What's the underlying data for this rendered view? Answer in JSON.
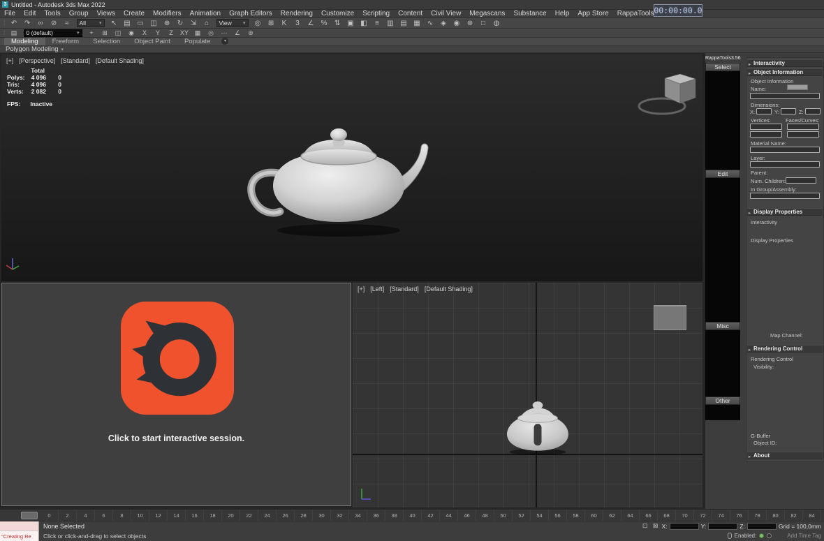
{
  "titlebar": {
    "app_icon": "3",
    "title": "Untitled - Autodesk 3ds Max 2022"
  },
  "menubar": {
    "items": [
      "File",
      "Edit",
      "Tools",
      "Group",
      "Views",
      "Create",
      "Modifiers",
      "Animation",
      "Graph Editors",
      "Rendering",
      "Customize",
      "Scripting",
      "Content",
      "Civil View",
      "Megascans",
      "Substance",
      "Help",
      "App Store",
      "RappaTools3"
    ]
  },
  "overlay": {
    "timecode": "00:00:00.0"
  },
  "toolbar1": {
    "filter_value": "All",
    "coord_value": "View",
    "icons_a": [
      {
        "name": "undo-icon",
        "glyph": "↶"
      },
      {
        "name": "redo-icon",
        "glyph": "↷"
      },
      {
        "name": "select-and-link-icon",
        "glyph": "∞"
      },
      {
        "name": "unlink-selection-icon",
        "glyph": "⊘"
      },
      {
        "name": "bind-to-space-warp-icon",
        "glyph": "≈"
      }
    ],
    "icons_b": [
      {
        "name": "select-object-icon",
        "glyph": "↖"
      },
      {
        "name": "select-by-name-icon",
        "glyph": "▤"
      },
      {
        "name": "rectangular-selection-region-icon",
        "glyph": "▭"
      },
      {
        "name": "window-crossing-icon",
        "glyph": "◫"
      },
      {
        "name": "select-and-move-icon",
        "glyph": "⊕"
      },
      {
        "name": "select-and-rotate-icon",
        "glyph": "↻"
      },
      {
        "name": "select-and-scale-icon",
        "glyph": "⇲"
      },
      {
        "name": "select-and-place-icon",
        "glyph": "⌂"
      }
    ],
    "icons_c": [
      {
        "name": "use-pivot-center-icon",
        "glyph": "◎"
      },
      {
        "name": "select-and-manipulate-icon",
        "glyph": "⊞"
      },
      {
        "name": "keyboard-override-icon",
        "glyph": "K"
      },
      {
        "name": "snaps-toggle-icon",
        "glyph": "3"
      },
      {
        "name": "angle-snap-icon",
        "glyph": "∠"
      },
      {
        "name": "percent-snap-icon",
        "glyph": "%"
      },
      {
        "name": "spinner-snap-icon",
        "glyph": "⇅"
      },
      {
        "name": "named-selection-sets-icon",
        "glyph": "▣"
      },
      {
        "name": "mirror-icon",
        "glyph": "◧"
      },
      {
        "name": "align-icon",
        "glyph": "≡"
      },
      {
        "name": "scene-explorer-icon",
        "glyph": "▥"
      },
      {
        "name": "layer-explorer-icon",
        "glyph": "▤"
      },
      {
        "name": "ribbon-icon",
        "glyph": "▦"
      },
      {
        "name": "curve-editor-icon",
        "glyph": "∿"
      },
      {
        "name": "schematic-view-icon",
        "glyph": "◈"
      },
      {
        "name": "material-editor-icon",
        "glyph": "◉"
      },
      {
        "name": "render-setup-icon",
        "glyph": "⊛"
      },
      {
        "name": "rendered-frame-window-icon",
        "glyph": "□"
      },
      {
        "name": "render-production-icon",
        "glyph": "◍"
      }
    ]
  },
  "toolbar2": {
    "layer_value": "0 (default)",
    "icons_left": [
      {
        "name": "layer-manager-icon",
        "glyph": "▤"
      }
    ],
    "icons_right": [
      {
        "name": "create-new-layer-icon",
        "glyph": "+"
      },
      {
        "name": "add-selection-to-layer-icon",
        "glyph": "⊞"
      },
      {
        "name": "select-objects-in-layer-icon",
        "glyph": "◫"
      },
      {
        "name": "set-current-layer-icon",
        "glyph": "◉"
      },
      {
        "name": "axis-x-constraint",
        "glyph": "X"
      },
      {
        "name": "axis-y-constraint",
        "glyph": "Y"
      },
      {
        "name": "axis-z-constraint",
        "glyph": "Z"
      },
      {
        "name": "axis-plane-constraint",
        "glyph": "XY"
      },
      {
        "name": "array-tool-icon",
        "glyph": "▦"
      },
      {
        "name": "snapshot-tool-icon",
        "glyph": "◎"
      },
      {
        "name": "spacing-tool-icon",
        "glyph": "⋯"
      },
      {
        "name": "measure-tool-icon",
        "glyph": "∠"
      },
      {
        "name": "transform-toolbox-icon",
        "glyph": "⊚"
      }
    ]
  },
  "ribbon": {
    "tabs": [
      {
        "label": "Modeling",
        "active": true
      },
      {
        "label": "Freeform"
      },
      {
        "label": "Selection"
      },
      {
        "label": "Object Paint"
      },
      {
        "label": "Populate"
      }
    ],
    "panel_label": "Polygon Modeling"
  },
  "viewports": {
    "perspective": {
      "menus": [
        "[+]",
        "[Perspective]",
        "[Standard]",
        "[Default Shading]"
      ],
      "stats": {
        "col_header": "Total",
        "rows": [
          {
            "label": "Polys:",
            "total": "4 096",
            "selected": "0"
          },
          {
            "label": "Tris:",
            "total": "4 096",
            "selected": "0"
          },
          {
            "label": "Verts:",
            "total": "2 082",
            "selected": "0"
          }
        ],
        "fps_label": "FPS:",
        "fps_value": "Inactive"
      }
    },
    "left": {
      "menus": [
        "[+]",
        "[Left]",
        "[Standard]",
        "[Default Shading]"
      ]
    },
    "corona": {
      "message": "Click to start interactive session."
    }
  },
  "rappatools": {
    "title": "RappaTools3.56",
    "buttons": [
      "Select",
      "Edit",
      "Misc",
      "Other"
    ]
  },
  "right_panel": {
    "headers": {
      "interactivity": "Interactivity",
      "object_information": "Object Information",
      "display_properties": "Display Properties",
      "rendering_control": "Rendering Control",
      "about": "About"
    },
    "labels": {
      "object_information": "Object Information",
      "name": "Name:",
      "dimensions": "Dimensions:",
      "x": "X:",
      "y": "Y:",
      "z": "Z:",
      "vertices": "Vertices:",
      "faces": "Faces/Curves:",
      "material": "Material Name:",
      "layer": "Layer:",
      "parent": "Parent:",
      "num_children": "Num. Children:",
      "in_group": "In Group/Assembly:",
      "interactivity_item": "Interactivity",
      "display_properties_item": "Display Properties",
      "map_channel": "Map Channel:",
      "rendering_control_item": "Rendering Control",
      "visibility": "Visibility:",
      "g_buffer": "G-Buffer",
      "object_id": "Object ID:"
    }
  },
  "timeline": {
    "ticks": [
      "0",
      "2",
      "4",
      "6",
      "8",
      "10",
      "12",
      "14",
      "16",
      "18",
      "20",
      "22",
      "24",
      "26",
      "28",
      "30",
      "32",
      "34",
      "36",
      "38",
      "40",
      "42",
      "44",
      "46",
      "48",
      "50",
      "52",
      "54",
      "56",
      "58",
      "60",
      "62",
      "64",
      "66",
      "68",
      "70",
      "72",
      "74",
      "76",
      "78",
      "80",
      "82",
      "84"
    ]
  },
  "statusbar": {
    "listener_text": "\"Creating Re",
    "status": "None Selected",
    "prompt": "Click or click-and-drag to select objects",
    "x": "X:",
    "y": "Y:",
    "z": "Z:",
    "grid": "Grid = 100,0mm",
    "enabled": "Enabled:",
    "add_time_tag": "Add Time Tag"
  },
  "colors": {
    "corona_orange": "#f1522e",
    "corona_swirl": "#2e3236",
    "listener_pink": "#f5dada",
    "listener_text_red": "#c03030",
    "enabled_green": "#7ec16a",
    "timecode_text": "#b6c2d8"
  }
}
